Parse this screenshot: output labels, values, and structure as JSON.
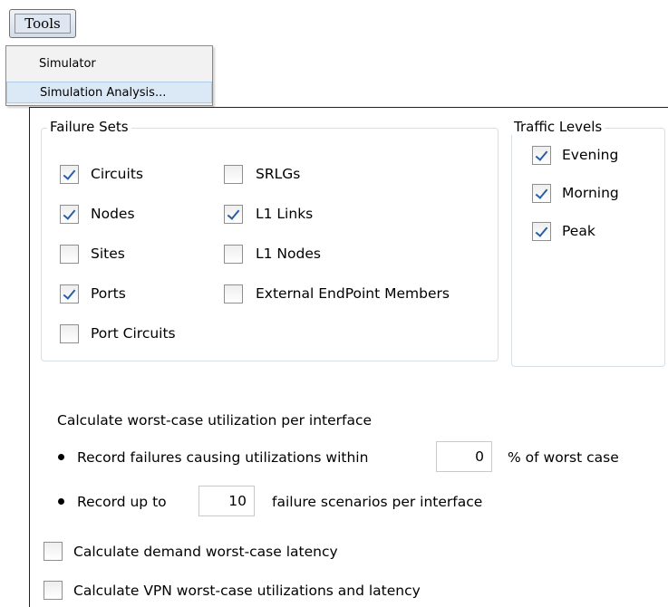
{
  "menu_bar": {
    "tools_label": "Tools"
  },
  "tools_menu": {
    "items": [
      {
        "label": "Simulator"
      },
      {
        "label": "Simulation Analysis..."
      }
    ]
  },
  "failure_sets": {
    "title": "Failure Sets",
    "items": [
      {
        "label": "Circuits",
        "checked": true
      },
      {
        "label": "Nodes",
        "checked": true
      },
      {
        "label": "Sites",
        "checked": false
      },
      {
        "label": "Ports",
        "checked": true
      },
      {
        "label": "Port Circuits",
        "checked": false
      },
      {
        "label": "SRLGs",
        "checked": false
      },
      {
        "label": "L1 Links",
        "checked": true
      },
      {
        "label": "L1 Nodes",
        "checked": false
      },
      {
        "label": "External EndPoint Members",
        "checked": false
      }
    ]
  },
  "traffic_levels": {
    "title": "Traffic Levels",
    "items": [
      {
        "label": "Evening",
        "checked": true
      },
      {
        "label": "Morning",
        "checked": true
      },
      {
        "label": "Peak",
        "checked": true
      }
    ]
  },
  "worst_case": {
    "heading": "Calculate worst-case utilization per interface",
    "within_prefix": "Record failures causing utilizations within",
    "within_value": "0",
    "within_suffix": "% of worst case",
    "upto_prefix": "Record up to",
    "upto_value": "10",
    "upto_suffix": "failure scenarios per interface"
  },
  "options": {
    "demand_latency": {
      "label": "Calculate demand worst-case latency",
      "checked": false
    },
    "vpn_latency": {
      "label": "Calculate VPN worst-case utilizations and latency",
      "checked": false
    }
  },
  "colors": {
    "check_mark": "#2a5ea4",
    "menu_highlight": "#dbe8f6"
  }
}
